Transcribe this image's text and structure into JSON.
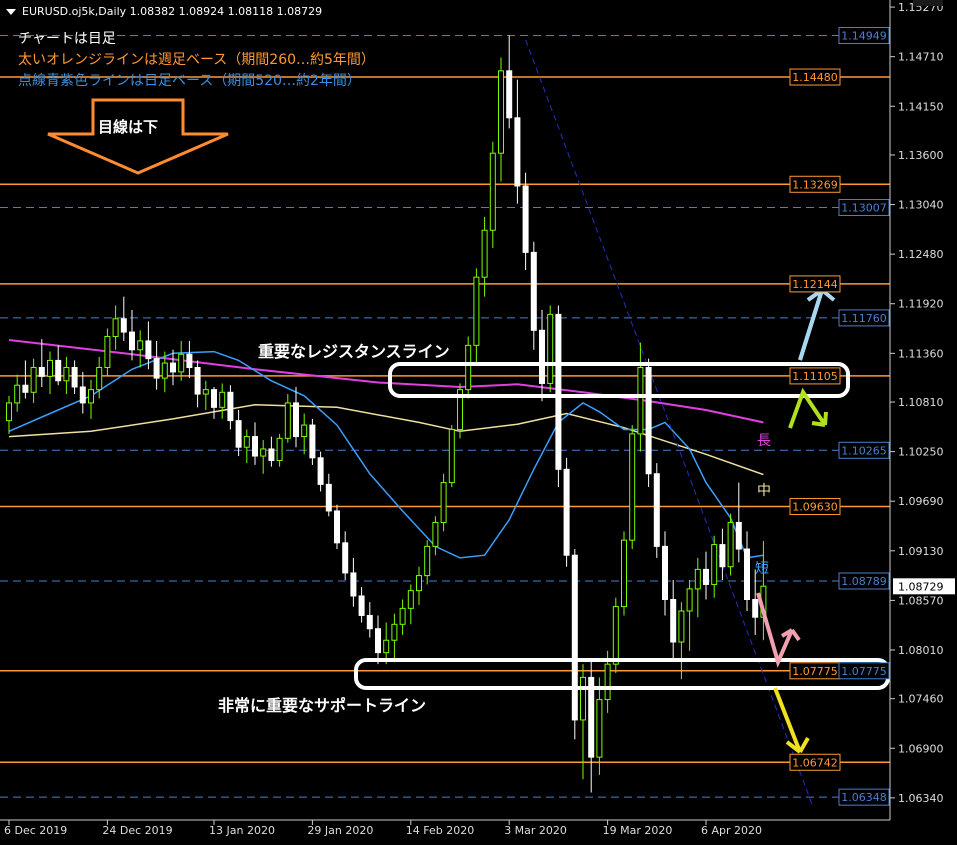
{
  "header": {
    "symbol_line": "EURUSD.oj5k,Daily  1.08382 1.08924 1.08118 1.08729"
  },
  "notes": {
    "line1": "チャートは日足",
    "line2": "太いオレンジラインは週足ベース（期間260…約5年間）",
    "line3": "点線青紫色ラインは日足ベース（期間520…約2年間）"
  },
  "callouts": {
    "down_arrow_label": "目線は下",
    "resistance": "重要なレジスタンスライン",
    "support": "非常に重要なサポートライン"
  },
  "ma_labels": {
    "long": "長",
    "mid": "中",
    "short": "短"
  },
  "colors": {
    "background": "#000000",
    "bull": "#7cfc00",
    "bear": "#ffffff",
    "orange_level": "#ff9933",
    "blue_level": "#4a7fd0",
    "ma_long": "#e040e0",
    "ma_mid": "#f0e0a0",
    "ma_short": "#3a9fff",
    "trendline": "#2030c0"
  },
  "chart_data": {
    "type": "candlestick",
    "symbol": "EURUSD.oj5k",
    "timeframe": "Daily",
    "last_ohlc": {
      "open": 1.08382,
      "high": 1.08924,
      "low": 1.08118,
      "close": 1.08729
    },
    "current_price": "1.08729",
    "ylim": [
      1.0609,
      1.1535
    ],
    "y_ticks": [
      "1.15270",
      "1.14710",
      "1.14150",
      "1.13600",
      "1.13040",
      "1.12480",
      "1.11920",
      "1.11360",
      "1.10810",
      "1.10250",
      "1.09690",
      "1.09130",
      "1.08570",
      "1.08010",
      "1.07460",
      "1.06900",
      "1.06340"
    ],
    "x_ticks": [
      {
        "i": 0,
        "label": "6 Dec 2019"
      },
      {
        "i": 12,
        "label": "24 Dec 2019"
      },
      {
        "i": 25,
        "label": "13 Jan 2020"
      },
      {
        "i": 37,
        "label": "29 Jan 2020"
      },
      {
        "i": 49,
        "label": "14 Feb 2020"
      },
      {
        "i": 61,
        "label": "3 Mar 2020"
      },
      {
        "i": 73,
        "label": "19 Mar 2020"
      },
      {
        "i": 85,
        "label": "6 Apr 2020"
      }
    ],
    "orange_levels": [
      {
        "label": "1.14480",
        "y": 1.1448
      },
      {
        "label": "1.13269",
        "y": 1.13269
      },
      {
        "label": "1.12144",
        "y": 1.12144
      },
      {
        "label": "1.11105",
        "y": 1.11105
      },
      {
        "label": "1.09630",
        "y": 1.0963
      },
      {
        "label": "1.07775",
        "y": 1.07775
      },
      {
        "label": "1.06742",
        "y": 1.06742
      }
    ],
    "blue_levels": [
      {
        "label": "1.14949",
        "y": 1.14949
      },
      {
        "label": "1.13007",
        "y": 1.13007
      },
      {
        "label": "1.11760",
        "y": 1.1176
      },
      {
        "label": "1.10265",
        "y": 1.10265
      },
      {
        "label": "1.08789",
        "y": 1.08789
      },
      {
        "label": "1.07775",
        "y": 1.07775
      },
      {
        "label": "1.06348",
        "y": 1.06348
      }
    ],
    "trendline": {
      "from": {
        "i": 63,
        "y": 1.149
      },
      "to": {
        "i": 98,
        "y": 1.0625
      }
    },
    "ma_long": [
      [
        0,
        1.1151
      ],
      [
        15,
        1.1135
      ],
      [
        30,
        1.1118
      ],
      [
        45,
        1.1103
      ],
      [
        55,
        1.1098
      ],
      [
        62,
        1.1101
      ],
      [
        70,
        1.1092
      ],
      [
        78,
        1.1082
      ],
      [
        85,
        1.1072
      ],
      [
        92,
        1.1058
      ]
    ],
    "ma_mid": [
      [
        0,
        1.1042
      ],
      [
        10,
        1.1048
      ],
      [
        20,
        1.1062
      ],
      [
        30,
        1.1078
      ],
      [
        40,
        1.1075
      ],
      [
        50,
        1.1058
      ],
      [
        55,
        1.1048
      ],
      [
        62,
        1.1056
      ],
      [
        68,
        1.1068
      ],
      [
        75,
        1.1052
      ],
      [
        85,
        1.1022
      ],
      [
        92,
        1.0999
      ]
    ],
    "ma_short": [
      [
        0,
        1.1048
      ],
      [
        5,
        1.1068
      ],
      [
        10,
        1.1088
      ],
      [
        15,
        1.1118
      ],
      [
        20,
        1.1136
      ],
      [
        25,
        1.1138
      ],
      [
        28,
        1.1128
      ],
      [
        32,
        1.1105
      ],
      [
        36,
        1.1088
      ],
      [
        40,
        1.1055
      ],
      [
        44,
        1.1
      ],
      [
        48,
        1.0958
      ],
      [
        52,
        1.0918
      ],
      [
        55,
        1.0905
      ],
      [
        58,
        1.0908
      ],
      [
        61,
        1.0948
      ],
      [
        64,
        1.1005
      ],
      [
        67,
        1.1058
      ],
      [
        70,
        1.108
      ],
      [
        72,
        1.107
      ],
      [
        75,
        1.105
      ],
      [
        78,
        1.105
      ],
      [
        80,
        1.1058
      ],
      [
        83,
        1.1028
      ],
      [
        85,
        1.099
      ],
      [
        88,
        1.095
      ],
      [
        90,
        1.0905
      ],
      [
        92,
        1.0908
      ]
    ],
    "candles": [
      [
        1.106,
        1.1088,
        1.1045,
        1.108
      ],
      [
        1.108,
        1.1112,
        1.107,
        1.11
      ],
      [
        1.11,
        1.1128,
        1.1085,
        1.1092
      ],
      [
        1.1092,
        1.113,
        1.108,
        1.112
      ],
      [
        1.112,
        1.1152,
        1.1098,
        1.111
      ],
      [
        1.111,
        1.1138,
        1.109,
        1.1128
      ],
      [
        1.1128,
        1.1145,
        1.11,
        1.1105
      ],
      [
        1.1105,
        1.1132,
        1.109,
        1.112
      ],
      [
        1.112,
        1.1128,
        1.109,
        1.1098
      ],
      [
        1.1098,
        1.1115,
        1.1068,
        1.108
      ],
      [
        1.108,
        1.1106,
        1.1062,
        1.1095
      ],
      [
        1.1095,
        1.1132,
        1.1085,
        1.112
      ],
      [
        1.112,
        1.1164,
        1.111,
        1.1155
      ],
      [
        1.1155,
        1.119,
        1.114,
        1.1175
      ],
      [
        1.1175,
        1.12,
        1.115,
        1.116
      ],
      [
        1.116,
        1.1185,
        1.1128,
        1.114
      ],
      [
        1.114,
        1.1162,
        1.112,
        1.115
      ],
      [
        1.115,
        1.1172,
        1.1118,
        1.113
      ],
      [
        1.113,
        1.115,
        1.1095,
        1.1108
      ],
      [
        1.1108,
        1.1138,
        1.1092,
        1.1125
      ],
      [
        1.1125,
        1.114,
        1.11,
        1.1115
      ],
      [
        1.1115,
        1.115,
        1.1105,
        1.1135
      ],
      [
        1.1135,
        1.115,
        1.1108,
        1.112
      ],
      [
        1.112,
        1.1128,
        1.1075,
        1.109
      ],
      [
        1.109,
        1.1105,
        1.1072,
        1.1095
      ],
      [
        1.1095,
        1.1098,
        1.1062,
        1.1075
      ],
      [
        1.1075,
        1.1102,
        1.1062,
        1.1092
      ],
      [
        1.1092,
        1.11,
        1.105,
        1.106
      ],
      [
        1.106,
        1.1072,
        1.102,
        1.103
      ],
      [
        1.103,
        1.105,
        1.1012,
        1.1042
      ],
      [
        1.1042,
        1.1058,
        1.101,
        1.102
      ],
      [
        1.102,
        1.1038,
        1.1,
        1.1028
      ],
      [
        1.1028,
        1.1042,
        1.1008,
        1.1015
      ],
      [
        1.1015,
        1.1045,
        1.1008,
        1.104
      ],
      [
        1.104,
        1.109,
        1.1035,
        1.108
      ],
      [
        1.108,
        1.1098,
        1.103,
        1.1042
      ],
      [
        1.1042,
        1.1068,
        1.1022,
        1.1055
      ],
      [
        1.1055,
        1.1062,
        1.101,
        1.1018
      ],
      [
        1.1018,
        1.1025,
        1.098,
        1.0988
      ],
      [
        1.0988,
        1.1,
        1.0952,
        1.0958
      ],
      [
        1.0958,
        1.0965,
        1.0915,
        1.0922
      ],
      [
        1.0922,
        1.0935,
        1.088,
        1.0888
      ],
      [
        1.0888,
        1.0905,
        1.085,
        1.0862
      ],
      [
        1.0862,
        1.0872,
        1.0832,
        1.084
      ],
      [
        1.084,
        1.0855,
        1.0815,
        1.0825
      ],
      [
        1.0825,
        1.084,
        1.0785,
        1.0798
      ],
      [
        1.0798,
        1.0832,
        1.0785,
        1.0812
      ],
      [
        1.0812,
        1.0842,
        1.0788,
        1.083
      ],
      [
        1.083,
        1.0858,
        1.0818,
        1.0848
      ],
      [
        1.0848,
        1.0875,
        1.083,
        1.0868
      ],
      [
        1.0868,
        1.0895,
        1.0852,
        1.0885
      ],
      [
        1.0885,
        1.0925,
        1.0875,
        1.0918
      ],
      [
        1.0918,
        1.0952,
        1.0908,
        1.0945
      ],
      [
        1.0945,
        1.1,
        1.0935,
        1.099
      ],
      [
        1.099,
        1.1055,
        1.0985,
        1.105
      ],
      [
        1.105,
        1.1102,
        1.104,
        1.1095
      ],
      [
        1.1095,
        1.1155,
        1.1085,
        1.1145
      ],
      [
        1.1145,
        1.1232,
        1.1125,
        1.1222
      ],
      [
        1.1222,
        1.129,
        1.12,
        1.1275
      ],
      [
        1.1275,
        1.1375,
        1.1255,
        1.1362
      ],
      [
        1.1362,
        1.147,
        1.133,
        1.1455
      ],
      [
        1.1455,
        1.1495,
        1.139,
        1.1402
      ],
      [
        1.1402,
        1.1445,
        1.1305,
        1.1325
      ],
      [
        1.1325,
        1.134,
        1.123,
        1.125
      ],
      [
        1.125,
        1.1262,
        1.114,
        1.1162
      ],
      [
        1.1162,
        1.1185,
        1.1082,
        1.1102
      ],
      [
        1.1102,
        1.119,
        1.1092,
        1.118
      ],
      [
        1.118,
        1.119,
        1.0985,
        1.1005
      ],
      [
        1.1005,
        1.1018,
        1.0895,
        1.0908
      ],
      [
        1.0908,
        1.0915,
        1.07,
        1.0722
      ],
      [
        1.0722,
        1.0785,
        1.0655,
        1.077
      ],
      [
        1.077,
        1.079,
        1.064,
        1.068
      ],
      [
        1.068,
        1.077,
        1.066,
        1.0745
      ],
      [
        1.0745,
        1.08,
        1.073,
        1.0785
      ],
      [
        1.0785,
        1.086,
        1.0775,
        1.085
      ],
      [
        1.085,
        1.0935,
        1.084,
        1.0925
      ],
      [
        1.0925,
        1.1055,
        1.0915,
        1.1045
      ],
      [
        1.1045,
        1.1148,
        1.1025,
        1.112
      ],
      [
        1.112,
        1.113,
        1.0985,
        1.1
      ],
      [
        1.1,
        1.1012,
        1.0905,
        1.0918
      ],
      [
        1.0918,
        1.0935,
        1.084,
        1.0858
      ],
      [
        1.0858,
        1.088,
        1.079,
        1.081
      ],
      [
        1.081,
        1.0855,
        1.0768,
        1.0845
      ],
      [
        1.0845,
        1.088,
        1.08,
        1.087
      ],
      [
        1.087,
        1.0905,
        1.0838,
        1.0892
      ],
      [
        1.0892,
        1.0912,
        1.0858,
        1.0875
      ],
      [
        1.0875,
        1.093,
        1.086,
        1.092
      ],
      [
        1.092,
        1.0938,
        1.088,
        1.0895
      ],
      [
        1.0895,
        1.0955,
        1.0885,
        1.0945
      ],
      [
        1.0945,
        1.099,
        1.09,
        1.0915
      ],
      [
        1.0915,
        1.0935,
        1.0845,
        1.0858
      ],
      [
        1.0858,
        1.0892,
        1.0818,
        1.0838
      ],
      [
        1.0838,
        1.0924,
        1.0812,
        1.0873
      ]
    ]
  }
}
